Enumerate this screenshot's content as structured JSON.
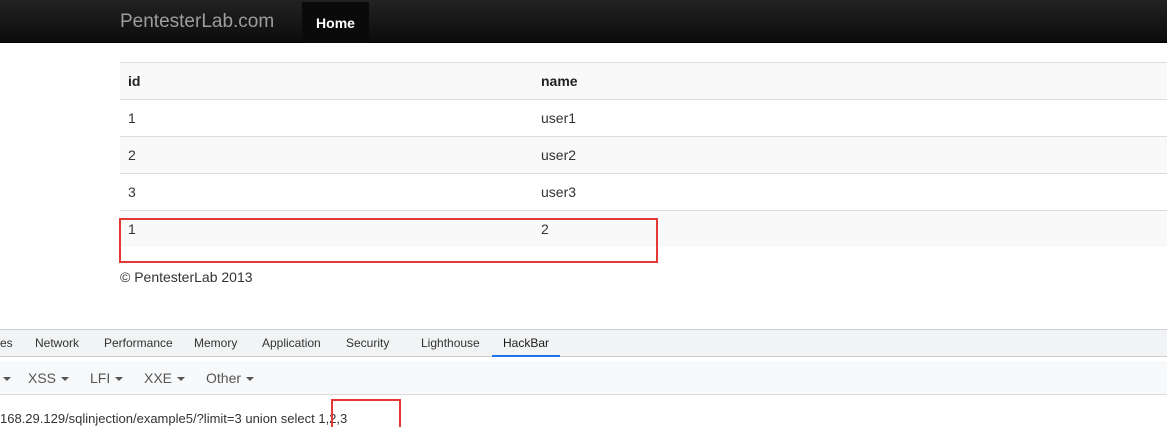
{
  "navbar": {
    "brand": "PentesterLab.com",
    "home": "Home"
  },
  "table": {
    "headers": [
      "id",
      "name"
    ],
    "rows": [
      [
        "1",
        "user1"
      ],
      [
        "2",
        "user2"
      ],
      [
        "3",
        "user3"
      ],
      [
        "1",
        "2"
      ]
    ]
  },
  "footer": "© PentesterLab 2013",
  "devtools": {
    "tabs": [
      "es",
      "Network",
      "Performance",
      "Memory",
      "Application",
      "Security",
      "Lighthouse",
      "HackBar"
    ],
    "active_tab": "HackBar"
  },
  "hackbar": {
    "menus": [
      "XSS",
      "LFI",
      "XXE",
      "Other"
    ],
    "url": "168.29.129/sqlinjection/example5/?limit=3 union select 1,2,3"
  },
  "colors": {
    "highlight": "#e53935",
    "active_tab_underline": "#1a73e8"
  }
}
